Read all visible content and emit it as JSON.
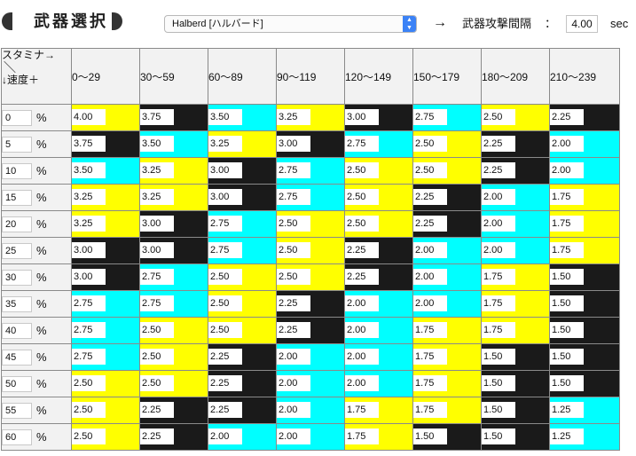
{
  "header": {
    "title": "武器選択",
    "weapon_selected": "Halberd [ハルバード]",
    "arrow": "→",
    "interval_label": "武器攻撃間隔",
    "colon": "：",
    "interval_value": "4.00",
    "interval_unit": "sec"
  },
  "table": {
    "corner": {
      "line1": "スタミナ→",
      "line2": "＼",
      "line3": "↓速度＋"
    },
    "percent_symbol": "%",
    "columns": [
      "0〜29",
      "30〜59",
      "60〜89",
      "90〜119",
      "120〜149",
      "150〜179",
      "180〜209",
      "210〜239"
    ],
    "rows": [
      {
        "stamina": "0",
        "cells": [
          [
            "4.00",
            "yellow"
          ],
          [
            "3.75",
            "black"
          ],
          [
            "3.50",
            "cyan"
          ],
          [
            "3.25",
            "yellow"
          ],
          [
            "3.00",
            "black"
          ],
          [
            "2.75",
            "cyan"
          ],
          [
            "2.50",
            "yellow"
          ],
          [
            "2.25",
            "black"
          ]
        ]
      },
      {
        "stamina": "5",
        "cells": [
          [
            "3.75",
            "black"
          ],
          [
            "3.50",
            "cyan"
          ],
          [
            "3.25",
            "yellow"
          ],
          [
            "3.00",
            "black"
          ],
          [
            "2.75",
            "cyan"
          ],
          [
            "2.50",
            "yellow"
          ],
          [
            "2.25",
            "black"
          ],
          [
            "2.00",
            "cyan"
          ]
        ]
      },
      {
        "stamina": "10",
        "cells": [
          [
            "3.50",
            "cyan"
          ],
          [
            "3.25",
            "yellow"
          ],
          [
            "3.00",
            "black"
          ],
          [
            "2.75",
            "cyan"
          ],
          [
            "2.50",
            "yellow"
          ],
          [
            "2.50",
            "yellow"
          ],
          [
            "2.25",
            "black"
          ],
          [
            "2.00",
            "cyan"
          ]
        ]
      },
      {
        "stamina": "15",
        "cells": [
          [
            "3.25",
            "yellow"
          ],
          [
            "3.25",
            "yellow"
          ],
          [
            "3.00",
            "black"
          ],
          [
            "2.75",
            "cyan"
          ],
          [
            "2.50",
            "yellow"
          ],
          [
            "2.25",
            "black"
          ],
          [
            "2.00",
            "cyan"
          ],
          [
            "1.75",
            "yellow"
          ]
        ]
      },
      {
        "stamina": "20",
        "cells": [
          [
            "3.25",
            "yellow"
          ],
          [
            "3.00",
            "black"
          ],
          [
            "2.75",
            "cyan"
          ],
          [
            "2.50",
            "yellow"
          ],
          [
            "2.50",
            "yellow"
          ],
          [
            "2.25",
            "black"
          ],
          [
            "2.00",
            "cyan"
          ],
          [
            "1.75",
            "yellow"
          ]
        ]
      },
      {
        "stamina": "25",
        "cells": [
          [
            "3.00",
            "black"
          ],
          [
            "3.00",
            "black"
          ],
          [
            "2.75",
            "cyan"
          ],
          [
            "2.50",
            "yellow"
          ],
          [
            "2.25",
            "black"
          ],
          [
            "2.00",
            "cyan"
          ],
          [
            "2.00",
            "cyan"
          ],
          [
            "1.75",
            "yellow"
          ]
        ]
      },
      {
        "stamina": "30",
        "cells": [
          [
            "3.00",
            "black"
          ],
          [
            "2.75",
            "cyan"
          ],
          [
            "2.50",
            "yellow"
          ],
          [
            "2.50",
            "yellow"
          ],
          [
            "2.25",
            "black"
          ],
          [
            "2.00",
            "cyan"
          ],
          [
            "1.75",
            "yellow"
          ],
          [
            "1.50",
            "black"
          ]
        ]
      },
      {
        "stamina": "35",
        "cells": [
          [
            "2.75",
            "cyan"
          ],
          [
            "2.75",
            "cyan"
          ],
          [
            "2.50",
            "yellow"
          ],
          [
            "2.25",
            "black"
          ],
          [
            "2.00",
            "cyan"
          ],
          [
            "2.00",
            "cyan"
          ],
          [
            "1.75",
            "yellow"
          ],
          [
            "1.50",
            "black"
          ]
        ]
      },
      {
        "stamina": "40",
        "cells": [
          [
            "2.75",
            "cyan"
          ],
          [
            "2.50",
            "yellow"
          ],
          [
            "2.50",
            "yellow"
          ],
          [
            "2.25",
            "black"
          ],
          [
            "2.00",
            "cyan"
          ],
          [
            "1.75",
            "yellow"
          ],
          [
            "1.75",
            "yellow"
          ],
          [
            "1.50",
            "black"
          ]
        ]
      },
      {
        "stamina": "45",
        "cells": [
          [
            "2.75",
            "cyan"
          ],
          [
            "2.50",
            "yellow"
          ],
          [
            "2.25",
            "black"
          ],
          [
            "2.00",
            "cyan"
          ],
          [
            "2.00",
            "cyan"
          ],
          [
            "1.75",
            "yellow"
          ],
          [
            "1.50",
            "black"
          ],
          [
            "1.50",
            "black"
          ]
        ]
      },
      {
        "stamina": "50",
        "cells": [
          [
            "2.50",
            "yellow"
          ],
          [
            "2.50",
            "yellow"
          ],
          [
            "2.25",
            "black"
          ],
          [
            "2.00",
            "cyan"
          ],
          [
            "2.00",
            "cyan"
          ],
          [
            "1.75",
            "yellow"
          ],
          [
            "1.50",
            "black"
          ],
          [
            "1.50",
            "black"
          ]
        ]
      },
      {
        "stamina": "55",
        "cells": [
          [
            "2.50",
            "yellow"
          ],
          [
            "2.25",
            "black"
          ],
          [
            "2.25",
            "black"
          ],
          [
            "2.00",
            "cyan"
          ],
          [
            "1.75",
            "yellow"
          ],
          [
            "1.75",
            "yellow"
          ],
          [
            "1.50",
            "black"
          ],
          [
            "1.25",
            "cyan"
          ]
        ]
      },
      {
        "stamina": "60",
        "cells": [
          [
            "2.50",
            "yellow"
          ],
          [
            "2.25",
            "black"
          ],
          [
            "2.00",
            "cyan"
          ],
          [
            "2.00",
            "cyan"
          ],
          [
            "1.75",
            "yellow"
          ],
          [
            "1.50",
            "black"
          ],
          [
            "1.50",
            "black"
          ],
          [
            "1.25",
            "cyan"
          ]
        ]
      }
    ]
  },
  "colors": {
    "yellow": "#ffff00",
    "cyan": "#00ffff",
    "black": "#1a1a1a",
    "header_bg": "#f2f2f2"
  },
  "icons": {
    "title_decoration": "pill-shape",
    "select_arrow": "up-down-chevron-icon"
  }
}
